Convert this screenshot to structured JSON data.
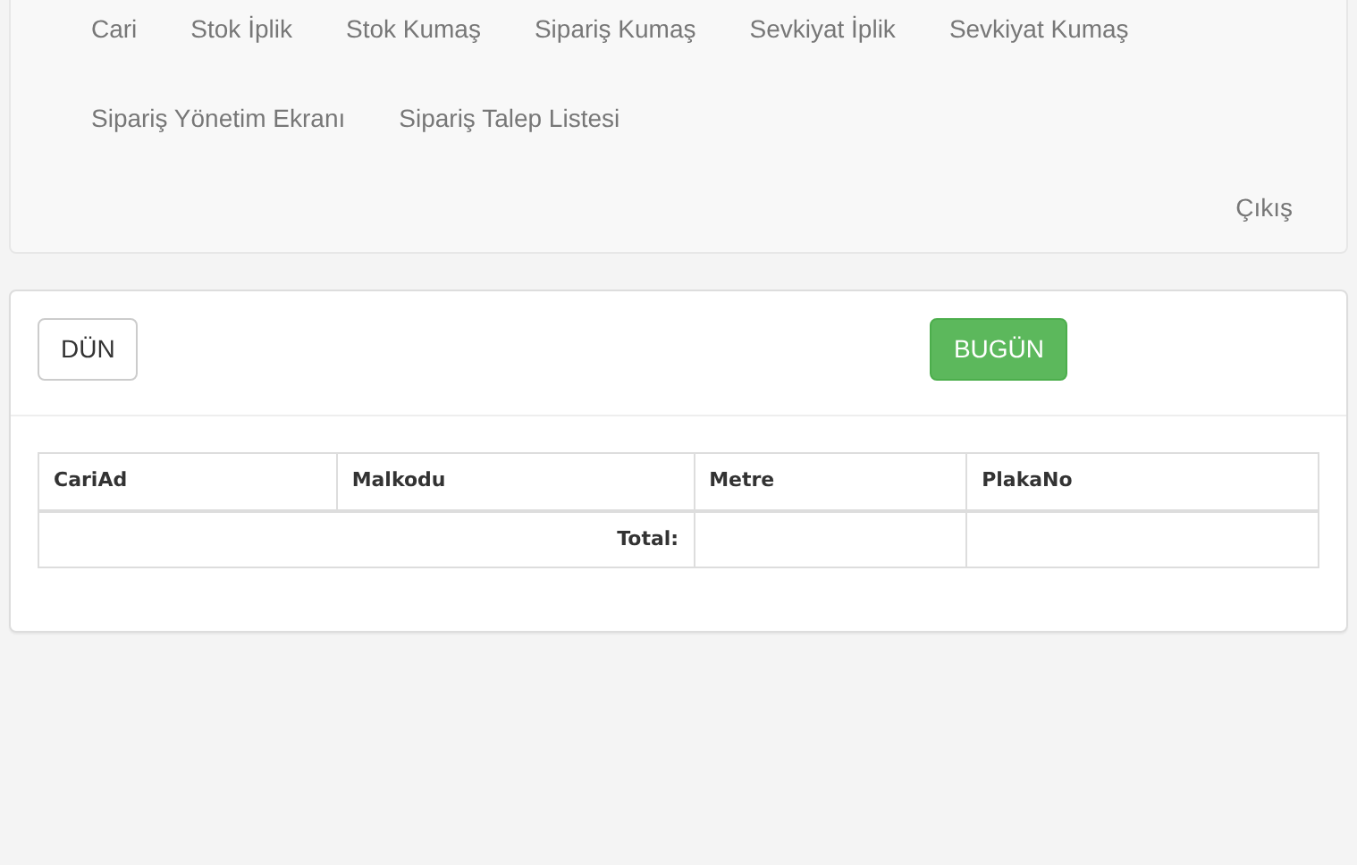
{
  "nav": {
    "items": [
      {
        "label": "Cari"
      },
      {
        "label": "Stok İplik"
      },
      {
        "label": "Stok Kumaş"
      },
      {
        "label": "Sipariş Kumaş"
      },
      {
        "label": "Sevkiyat İplik"
      },
      {
        "label": "Sevkiyat Kumaş"
      },
      {
        "label": "Sipariş Yönetim Ekranı"
      },
      {
        "label": "Sipariş Talep Listesi"
      }
    ],
    "logout": "Çıkış"
  },
  "buttons": [
    {
      "label": "DÜN",
      "kind": "default"
    },
    {
      "label": "BUGÜN",
      "kind": "success"
    }
  ],
  "table": {
    "columns": [
      "CariAd",
      "Malkodu",
      "Metre",
      "PlakaNo"
    ],
    "total_label": "Total:"
  }
}
